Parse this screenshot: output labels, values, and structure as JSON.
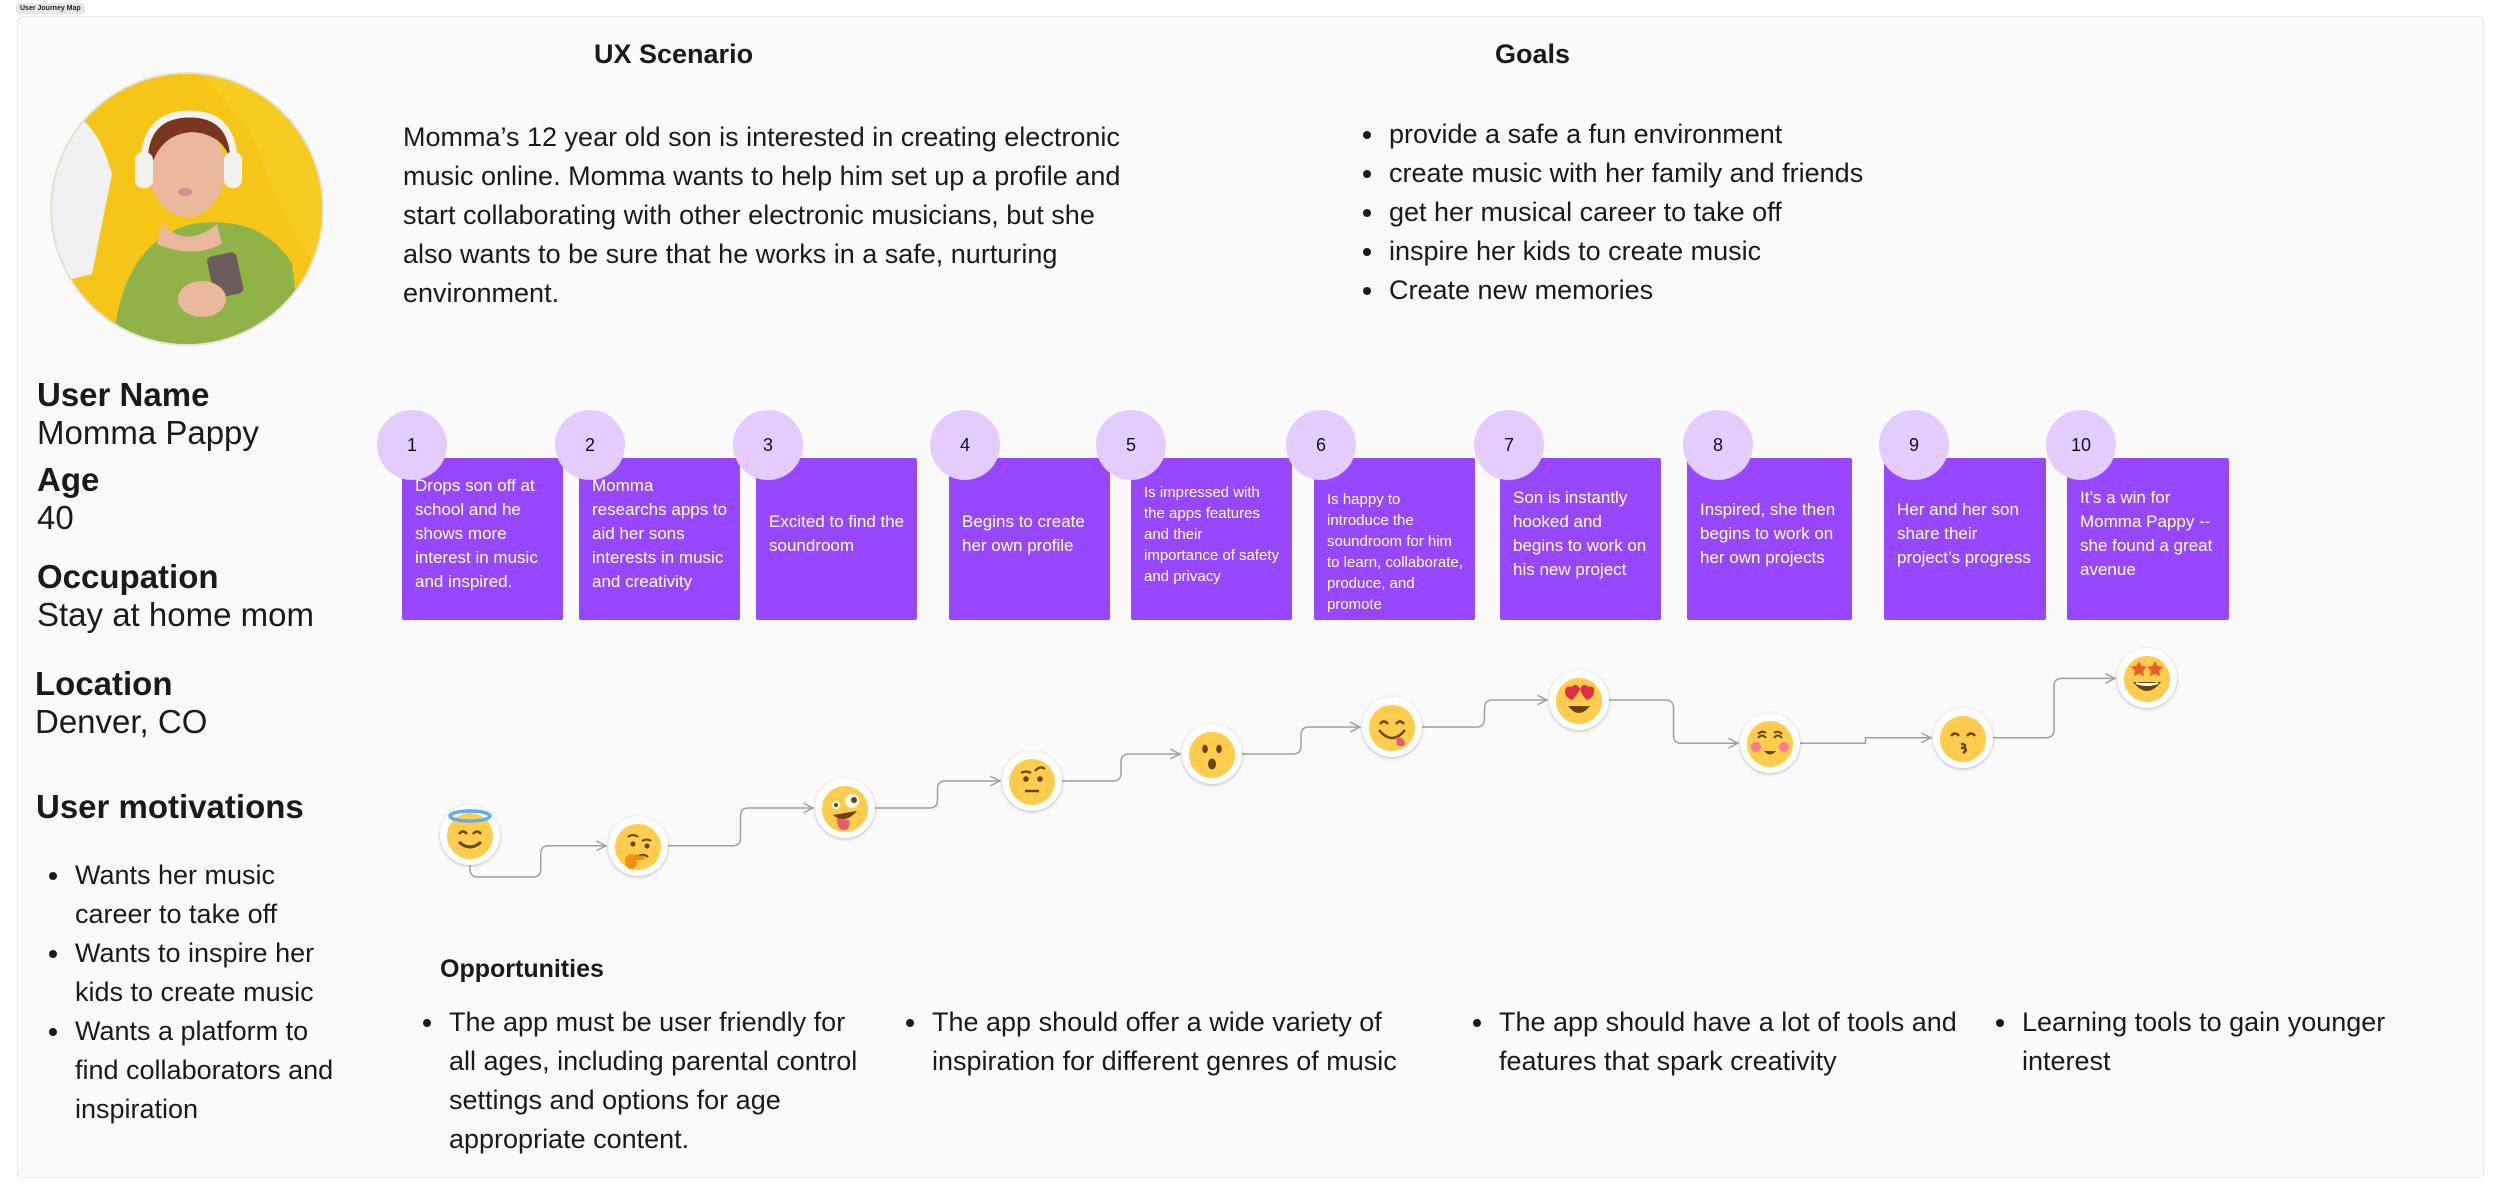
{
  "frame_label": "User Journey Map",
  "persona": {
    "photo_alt": "woman-with-headphones-and-phone-photo",
    "fields": [
      {
        "label": "User Name",
        "value": "Momma Pappy"
      },
      {
        "label": "Age",
        "value": "40"
      },
      {
        "label": "Occupation",
        "value": "Stay at home mom"
      },
      {
        "label": "Location",
        "value": "Denver, CO"
      }
    ],
    "motivations_title": "User motivations",
    "motivations": [
      "Wants her music career to take off",
      "Wants to inspire her kids to create music",
      "Wants a platform to find collaborators and inspiration"
    ]
  },
  "scenario": {
    "title": "UX Scenario",
    "text": "Momma’s 12 year old son is interested in creating electronic music online. Momma wants to help him set up a profile and start collaborating with other electronic musicians, but she also wants to be sure that he works in a safe, nurturing environment."
  },
  "goals": {
    "title": "Goals",
    "items": [
      "provide a safe a fun environment",
      "create music with her family and friends",
      "get her musical career to take off",
      "inspire her kids to create music",
      "Create new memories"
    ]
  },
  "steps": [
    {
      "number": "1",
      "text": "Drops son off at school and he shows more interest in music and inspired.",
      "emotion": "smiling-face-with-halo",
      "emotion_level": 1
    },
    {
      "number": "2",
      "text": "Momma researchs apps to aid her sons interests in music and creativity",
      "emotion": "thinking-face",
      "emotion_level": 0.6
    },
    {
      "number": "3",
      "text": "Excited to find the soundroom",
      "emotion": "zany-face",
      "emotion_level": 2
    },
    {
      "number": "4",
      "text": "Begins to create her own profile",
      "emotion": "face-with-raised-eyebrow",
      "emotion_level": 3
    },
    {
      "number": "5",
      "text": "Is impressed with the apps features and their importance of safety and privacy",
      "emotion": "hushed-face",
      "emotion_level": 4
    },
    {
      "number": "6",
      "text": "Is happy to introduce the soundroom for him to learn, collaborate, produce, and promote",
      "emotion": "face-savoring-food",
      "emotion_level": 5
    },
    {
      "number": "7",
      "text": "Son is instantly hooked and begins to work on his new project",
      "emotion": "heart-eyes-face",
      "emotion_level": 6
    },
    {
      "number": "8",
      "text": "Inspired, she then begins to work on her own projects",
      "emotion": "smiling-face-blushing",
      "emotion_level": 4.4
    },
    {
      "number": "9",
      "text": "Her and her son share their project’s progress",
      "emotion": "kissing-face-smiling-eyes",
      "emotion_level": 4.6
    },
    {
      "number": "10",
      "text": "It’s a win for Momma Pappy -- she found a great avenue",
      "emotion": "star-struck-face",
      "emotion_level": 6.8
    }
  ],
  "opportunities": {
    "title": "Opportunities",
    "items": [
      "The app must be user friendly for all ages, including parental control settings and options for age appropriate content.",
      "The app should offer a wide variety of inspiration for different genres of music",
      "The app should have a lot of tools and features that spark creativity",
      "Learning tools to gain younger interest"
    ]
  },
  "colors": {
    "card": "#9747FF",
    "step_circle": "#E4CCFF",
    "card_text": "#FFFFFF",
    "connector": "#A0A0A0",
    "canvas": "#FAFAFA"
  }
}
